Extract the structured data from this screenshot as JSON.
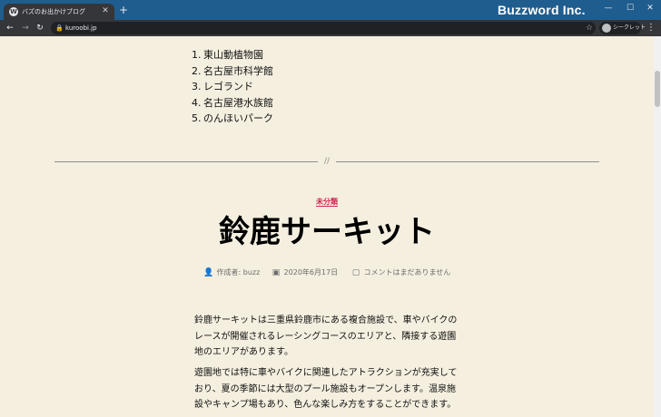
{
  "browser": {
    "tab_title": "バズのお出かけブログ",
    "tab_favicon": "W",
    "url": "kuroobi.jp",
    "incognito_label": "シークレット",
    "brand": "Buzzword Inc.",
    "icons": {
      "minimize": "minimize-icon",
      "maximize": "maximize-icon",
      "close": "close-icon"
    }
  },
  "content": {
    "list": [
      {
        "num": "1.",
        "text": "東山動植物園"
      },
      {
        "num": "2.",
        "text": "名古屋市科学館"
      },
      {
        "num": "3.",
        "text": "レゴランド"
      },
      {
        "num": "4.",
        "text": "名古屋港水族館"
      },
      {
        "num": "5.",
        "text": "のんほいパーク"
      }
    ],
    "separator": "//",
    "post": {
      "category": "未分類",
      "title": "鈴鹿サーキット",
      "author": "作成者: buzz",
      "date": "2020年6月17日",
      "comments": "コメントはまだありません",
      "paragraphs": [
        "鈴鹿サーキットは三重県鈴鹿市にある複合施設で、車やバイクのレースが開催されるレーシングコースのエリアと、隣接する遊園地のエリアがあります。",
        "遊園地では特に車やバイクに関連したアトラクションが充実しており、夏の季節には大型のプール施設もオープンします。温泉施設やキャンプ場もあり、色んな楽しみ方をすることができます。"
      ]
    },
    "accent_color": "#cd2653",
    "background_color": "#f5efe0"
  }
}
